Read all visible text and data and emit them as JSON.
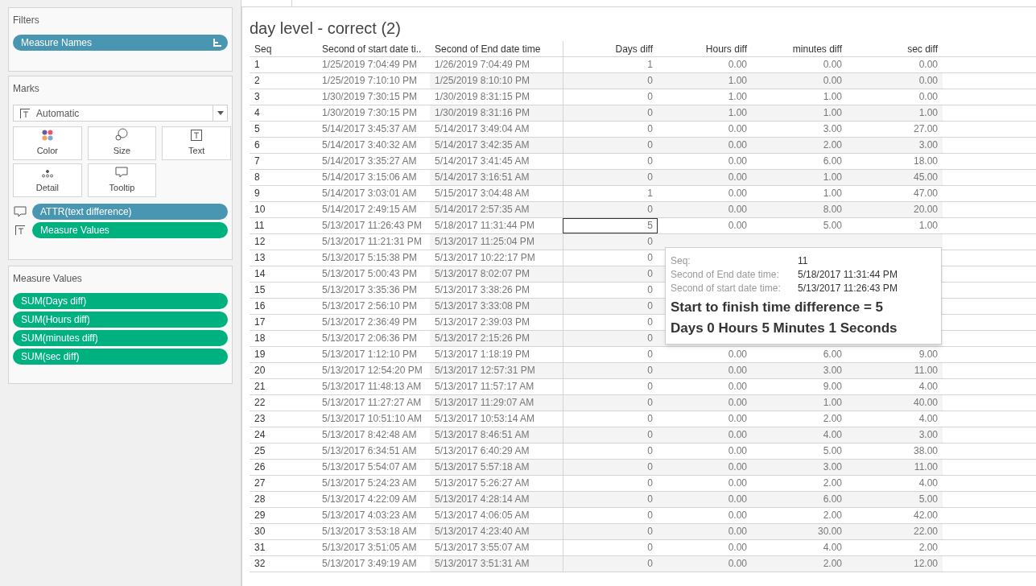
{
  "filters": {
    "title": "Filters",
    "pills": [
      {
        "label": "Measure Names",
        "color": "#4996b2"
      }
    ]
  },
  "marks": {
    "title": "Marks",
    "mark_type": "Automatic",
    "cards": [
      {
        "label": "Color",
        "kind": "color"
      },
      {
        "label": "Size",
        "kind": "size"
      },
      {
        "label": "Text",
        "kind": "text"
      },
      {
        "label": "Detail",
        "kind": "detail"
      },
      {
        "label": "Tooltip",
        "kind": "tooltip"
      }
    ],
    "pills": [
      {
        "label": "ATTR(text difference)",
        "kind": "tooltip",
        "color": "#4996b2"
      },
      {
        "label": "Measure Values",
        "kind": "text",
        "color": "#00b180"
      }
    ]
  },
  "measure_values": {
    "title": "Measure Values",
    "pills": [
      {
        "label": "SUM(Days diff)",
        "color": "#00b180"
      },
      {
        "label": "SUM(Hours diff)",
        "color": "#00b180"
      },
      {
        "label": "SUM(minutes diff)",
        "color": "#00b180"
      },
      {
        "label": "SUM(sec diff)",
        "color": "#00b180"
      }
    ]
  },
  "sheet": {
    "title": "day level - correct (2)",
    "columns": [
      "Seq",
      "Second of start date ti..",
      "Second of End date time",
      "Days diff",
      "Hours diff",
      "minutes diff",
      "sec diff"
    ],
    "rows": [
      {
        "cells": [
          "1",
          "1/25/2019 7:04:49 PM",
          "1/26/2019 7:04:49 PM",
          "1",
          "0.00",
          "0.00",
          "0.00"
        ],
        "selected": false
      },
      {
        "cells": [
          "2",
          "1/25/2019 7:10:10 PM",
          "1/25/2019 8:10:10 PM",
          "0",
          "1.00",
          "0.00",
          "0.00"
        ],
        "selected": false
      },
      {
        "cells": [
          "3",
          "1/30/2019 7:30:15 PM",
          "1/30/2019 8:31:15 PM",
          "0",
          "1.00",
          "1.00",
          "0.00"
        ],
        "selected": false
      },
      {
        "cells": [
          "4",
          "1/30/2019 7:30:15 PM",
          "1/30/2019 8:31:16 PM",
          "0",
          "1.00",
          "1.00",
          "1.00"
        ],
        "selected": false
      },
      {
        "cells": [
          "5",
          "5/14/2017 3:45:37 AM",
          "5/14/2017 3:49:04 AM",
          "0",
          "0.00",
          "3.00",
          "27.00"
        ],
        "selected": false
      },
      {
        "cells": [
          "6",
          "5/14/2017 3:40:32 AM",
          "5/14/2017 3:42:35 AM",
          "0",
          "0.00",
          "2.00",
          "3.00"
        ],
        "selected": false
      },
      {
        "cells": [
          "7",
          "5/14/2017 3:35:27 AM",
          "5/14/2017 3:41:45 AM",
          "0",
          "0.00",
          "6.00",
          "18.00"
        ],
        "selected": false
      },
      {
        "cells": [
          "8",
          "5/14/2017 3:15:06 AM",
          "5/14/2017 3:16:51 AM",
          "0",
          "0.00",
          "1.00",
          "45.00"
        ],
        "selected": false
      },
      {
        "cells": [
          "9",
          "5/14/2017 3:03:01 AM",
          "5/15/2017 3:04:48 AM",
          "1",
          "0.00",
          "1.00",
          "47.00"
        ],
        "selected": false
      },
      {
        "cells": [
          "10",
          "5/14/2017 2:49:15 AM",
          "5/14/2017 2:57:35 AM",
          "0",
          "0.00",
          "8.00",
          "20.00"
        ],
        "selected": false
      },
      {
        "cells": [
          "11",
          "5/13/2017 11:26:43 PM",
          "5/18/2017 11:31:44 PM",
          "5",
          "0.00",
          "5.00",
          "1.00"
        ],
        "selected": true
      },
      {
        "cells": [
          "12",
          "5/13/2017 11:21:31 PM",
          "5/13/2017 11:25:04 PM",
          "0"
        ],
        "selected": false
      },
      {
        "cells": [
          "13",
          "5/13/2017 5:15:38 PM",
          "5/13/2017 10:22:17 PM",
          "0"
        ],
        "selected": false
      },
      {
        "cells": [
          "14",
          "5/13/2017 5:00:43 PM",
          "5/13/2017 8:02:07 PM",
          "0"
        ],
        "selected": false
      },
      {
        "cells": [
          "15",
          "5/13/2017 3:35:36 PM",
          "5/13/2017 3:38:26 PM",
          "0"
        ],
        "selected": false
      },
      {
        "cells": [
          "16",
          "5/13/2017 2:56:10 PM",
          "5/13/2017 3:33:08 PM",
          "0"
        ],
        "selected": false
      },
      {
        "cells": [
          "17",
          "5/13/2017 2:36:49 PM",
          "5/13/2017 2:39:03 PM",
          "0"
        ],
        "selected": false
      },
      {
        "cells": [
          "18",
          "5/13/2017 2:06:36 PM",
          "5/13/2017 2:15:26 PM",
          "0"
        ],
        "selected": false
      },
      {
        "cells": [
          "19",
          "5/13/2017 1:12:10 PM",
          "5/13/2017 1:18:19 PM",
          "0",
          "0.00",
          "6.00",
          "9.00"
        ],
        "selected": false
      },
      {
        "cells": [
          "20",
          "5/13/2017 12:54:20 PM",
          "5/13/2017 12:57:31 PM",
          "0",
          "0.00",
          "3.00",
          "11.00"
        ],
        "selected": false
      },
      {
        "cells": [
          "21",
          "5/13/2017 11:48:13 AM",
          "5/13/2017 11:57:17 AM",
          "0",
          "0.00",
          "9.00",
          "4.00"
        ],
        "selected": false
      },
      {
        "cells": [
          "22",
          "5/13/2017 11:27:27 AM",
          "5/13/2017 11:29:07 AM",
          "0",
          "0.00",
          "1.00",
          "40.00"
        ],
        "selected": false
      },
      {
        "cells": [
          "23",
          "5/13/2017 10:51:10 AM",
          "5/13/2017 10:53:14 AM",
          "0",
          "0.00",
          "2.00",
          "4.00"
        ],
        "selected": false
      },
      {
        "cells": [
          "24",
          "5/13/2017 8:42:48 AM",
          "5/13/2017 8:46:51 AM",
          "0",
          "0.00",
          "4.00",
          "3.00"
        ],
        "selected": false
      },
      {
        "cells": [
          "25",
          "5/13/2017 6:34:51 AM",
          "5/13/2017 6:40:29 AM",
          "0",
          "0.00",
          "5.00",
          "38.00"
        ],
        "selected": false
      },
      {
        "cells": [
          "26",
          "5/13/2017 5:54:07 AM",
          "5/13/2017 5:57:18 AM",
          "0",
          "0.00",
          "3.00",
          "11.00"
        ],
        "selected": false
      },
      {
        "cells": [
          "27",
          "5/13/2017 5:24:23 AM",
          "5/13/2017 5:26:27 AM",
          "0",
          "0.00",
          "2.00",
          "4.00"
        ],
        "selected": false
      },
      {
        "cells": [
          "28",
          "5/13/2017 4:22:09 AM",
          "5/13/2017 4:28:14 AM",
          "0",
          "0.00",
          "6.00",
          "5.00"
        ],
        "selected": false
      },
      {
        "cells": [
          "29",
          "5/13/2017 4:03:23 AM",
          "5/13/2017 4:06:05 AM",
          "0",
          "0.00",
          "2.00",
          "42.00"
        ],
        "selected": false
      },
      {
        "cells": [
          "30",
          "5/13/2017 3:53:18 AM",
          "5/13/2017 4:23:40 AM",
          "0",
          "0.00",
          "30.00",
          "22.00"
        ],
        "selected": false
      },
      {
        "cells": [
          "31",
          "5/13/2017 3:51:05 AM",
          "5/13/2017 3:55:07 AM",
          "0",
          "0.00",
          "4.00",
          "2.00"
        ],
        "selected": false
      },
      {
        "cells": [
          "32",
          "5/13/2017 3:49:19 AM",
          "5/13/2017 3:51:31 AM",
          "0",
          "0.00",
          "2.00",
          "12.00"
        ],
        "selected": false
      }
    ]
  },
  "tooltip": {
    "fields": [
      {
        "label": "Seq:",
        "value": "11"
      },
      {
        "label": "Second of End date time:",
        "value": "5/18/2017 11:31:44 PM"
      },
      {
        "label": "Second of start date time:",
        "value": "5/13/2017 11:26:43 PM"
      }
    ],
    "lines": [
      "Start to finish time difference = 5",
      "Days 0 Hours 5 Minutes 1 Seconds"
    ]
  }
}
